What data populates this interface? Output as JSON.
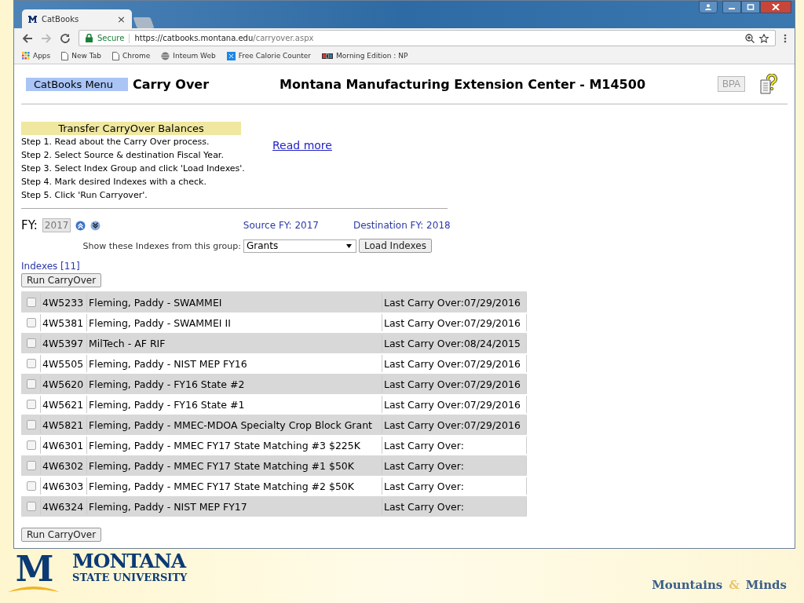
{
  "browser": {
    "tabs": [
      {
        "title": "CatBooks",
        "close": "×",
        "selected": true
      }
    ],
    "address": {
      "secure_label": "Secure",
      "url_host": "https://catbooks.montana.edu",
      "url_path": "/carryover.aspx"
    },
    "bookmarks": [
      {
        "label": "Apps",
        "kind": "apps"
      },
      {
        "label": "New Tab",
        "kind": "page"
      },
      {
        "label": "Chrome",
        "kind": "page"
      },
      {
        "label": "Inteum Web",
        "kind": "globe"
      },
      {
        "label": "Free Calorie Counter",
        "kind": "app"
      },
      {
        "label": "Morning Edition : NP",
        "kind": "radio"
      }
    ]
  },
  "header": {
    "menu_button": "CatBooks Menu",
    "page_title": "Carry Over",
    "org_title": "Montana Manufacturing Extension Center - M14500",
    "bpa_button": {
      "label": "BPA",
      "disabled": true
    }
  },
  "instructions": {
    "heading": "Transfer CarryOver Balances",
    "steps": [
      "Step 1. Read about the Carry Over process.",
      "Step 2. Select Source & destination Fiscal Year.",
      "Step 3. Select Index Group and click 'Load Indexes'.",
      "Step 4. Mark desired Indexes with a check.",
      "Step 5. Click 'Run Carryover'."
    ],
    "read_more": "Read more"
  },
  "fiscal_year": {
    "label": "FY:",
    "value": "2017",
    "source": "Source FY: 2017",
    "destination": "Destination FY: 2018"
  },
  "group": {
    "label": "Show these Indexes from this group:",
    "value": "Grants",
    "load_button": "Load Indexes"
  },
  "indexes_count": "Indexes [11]",
  "run_button_top": "Run CarryOver",
  "rows": [
    {
      "checked": false,
      "code": "4W5233",
      "name": "Fleming, Paddy - SWAMMEI",
      "last": "Last Carry Over:07/29/2016"
    },
    {
      "checked": false,
      "code": "4W5381",
      "name": "Fleming, Paddy - SWAMMEI II",
      "last": "Last Carry Over:07/29/2016"
    },
    {
      "checked": false,
      "code": "4W5397",
      "name": "MilTech - AF RIF",
      "last": "Last Carry Over:08/24/2015"
    },
    {
      "checked": false,
      "code": "4W5505",
      "name": "Fleming, Paddy - NIST MEP FY16",
      "last": "Last Carry Over:07/29/2016"
    },
    {
      "checked": false,
      "code": "4W5620",
      "name": "Fleming, Paddy - FY16 State #2",
      "last": "Last Carry Over:07/29/2016"
    },
    {
      "checked": false,
      "code": "4W5621",
      "name": "Fleming, Paddy - FY16 State #1",
      "last": "Last Carry Over:07/29/2016"
    },
    {
      "checked": false,
      "code": "4W5821",
      "name": "Fleming, Paddy - MMEC-MDOA Specialty Crop Block Grant",
      "last": "Last Carry Over:07/29/2016"
    },
    {
      "checked": false,
      "code": "4W6301",
      "name": "Fleming, Paddy - MMEC FY17 State Matching #3 $225K",
      "last": "Last Carry Over:"
    },
    {
      "checked": false,
      "code": "4W6302",
      "name": "Fleming, Paddy - MMEC FY17 State Matching #1 $50K",
      "last": "Last Carry Over:"
    },
    {
      "checked": false,
      "code": "4W6303",
      "name": "Fleming, Paddy - MMEC FY17 State Matching #2 $50K",
      "last": "Last Carry Over:"
    },
    {
      "checked": false,
      "code": "4W6324",
      "name": "Fleming, Paddy - NIST MEP FY17",
      "last": "Last Carry Over:"
    }
  ],
  "run_button_bottom": "Run CarryOver",
  "footer": {
    "logo_letter": "M",
    "university_line1": "MONTANA",
    "university_line2": "STATE UNIVERSITY",
    "tagline": [
      "Mountains",
      "&",
      "Minds"
    ]
  }
}
